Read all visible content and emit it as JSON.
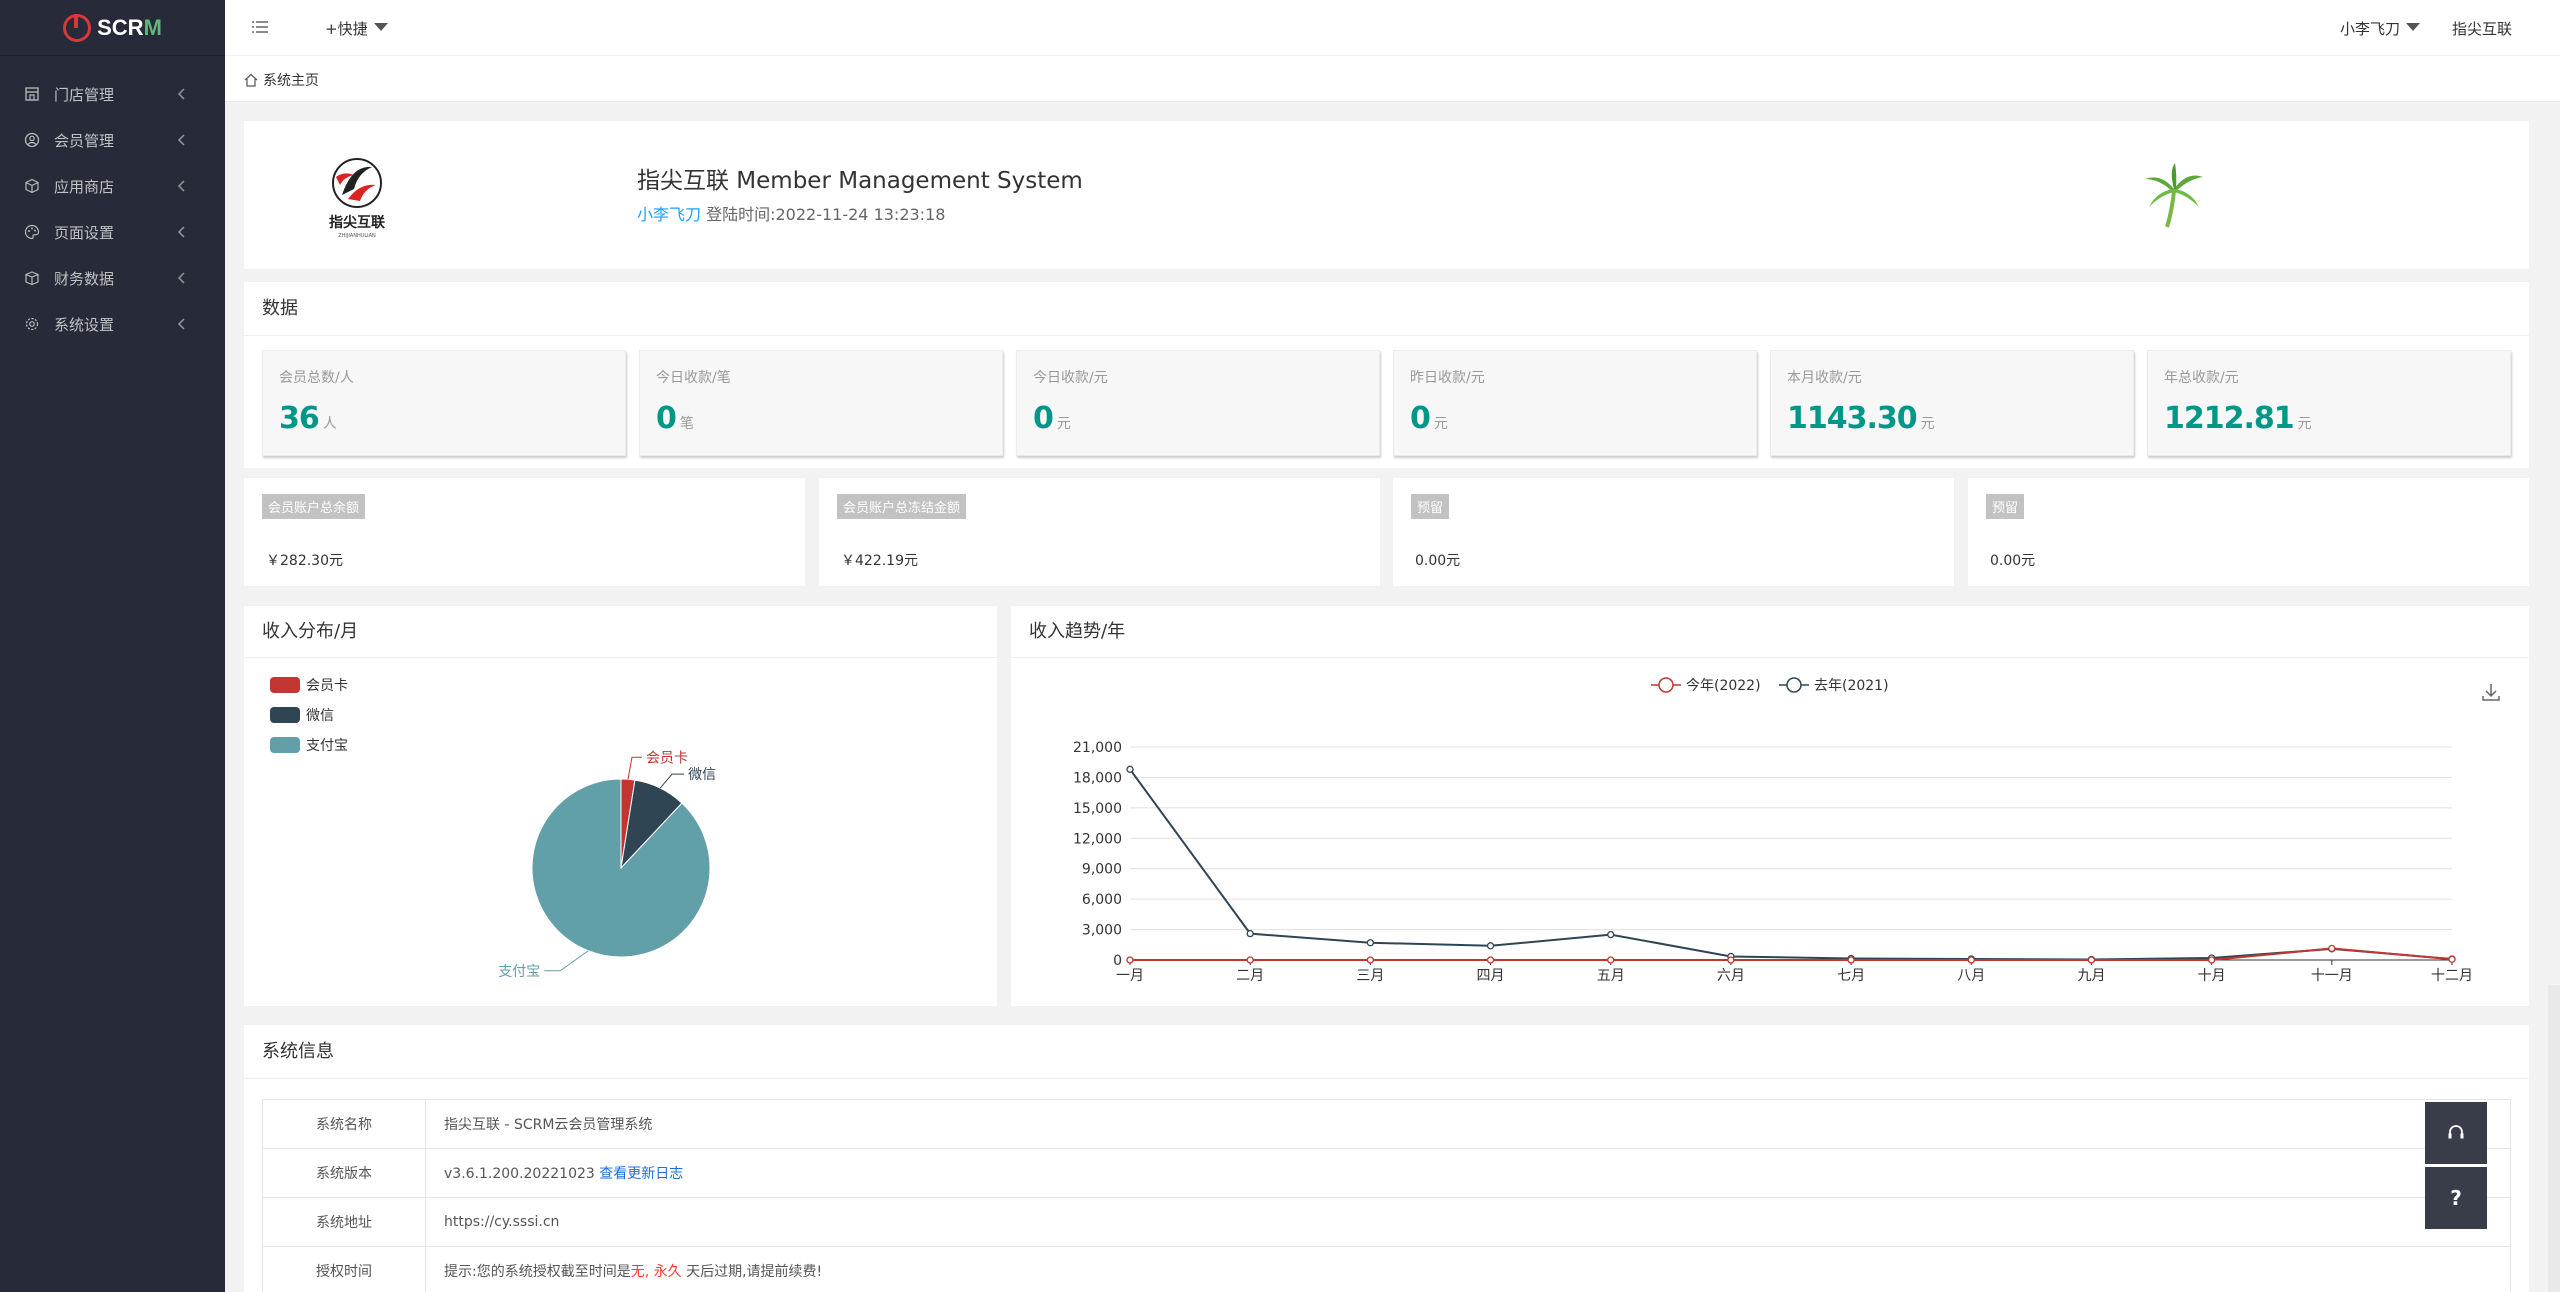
{
  "app": {
    "logo_text_main": "SCR",
    "logo_text_accent": "M"
  },
  "sidebar": {
    "items": [
      {
        "label": "门店管理",
        "icon": "store-icon"
      },
      {
        "label": "会员管理",
        "icon": "user-circle-icon"
      },
      {
        "label": "应用商店",
        "icon": "cube-icon"
      },
      {
        "label": "页面设置",
        "icon": "palette-icon"
      },
      {
        "label": "财务数据",
        "icon": "box-icon"
      },
      {
        "label": "系统设置",
        "icon": "gear-icon"
      }
    ]
  },
  "header": {
    "quick_label": "+快捷",
    "user_name": "小李飞刀",
    "brand": "指尖互联"
  },
  "breadcrumb": {
    "home": "系统主页"
  },
  "welcome": {
    "title": "指尖互联 Member Management System",
    "user": "小李飞刀",
    "login_text": "登陆时间:2022-11-24 13:23:18",
    "logo_caption": "指尖互联",
    "logo_sub": "ZHIJIANHULIAN"
  },
  "data_section": {
    "title": "数据",
    "stats": [
      {
        "label": "会员总数/人",
        "value": "36",
        "unit": "人"
      },
      {
        "label": "今日收款/笔",
        "value": "0",
        "unit": "笔"
      },
      {
        "label": "今日收款/元",
        "value": "0",
        "unit": "元"
      },
      {
        "label": "昨日收款/元",
        "value": "0",
        "unit": "元"
      },
      {
        "label": "本月收款/元",
        "value": "1143.30",
        "unit": "元"
      },
      {
        "label": "年总收款/元",
        "value": "1212.81",
        "unit": "元"
      }
    ]
  },
  "balances": [
    {
      "label": "会员账户总余额",
      "value": "￥282.30元"
    },
    {
      "label": "会员账户总冻结金额",
      "value": "￥422.19元"
    },
    {
      "label": "预留",
      "value": "0.00元"
    },
    {
      "label": "预留",
      "value": "0.00元"
    }
  ],
  "pie_card": {
    "title": "收入分布/月"
  },
  "line_card": {
    "title": "收入趋势/年"
  },
  "chart_data": [
    {
      "type": "pie",
      "title": "收入分布/月",
      "legend": "top-left",
      "slices": [
        {
          "name": "会员卡",
          "value": 2.5,
          "color": "#c23531"
        },
        {
          "name": "微信",
          "value": 9.5,
          "color": "#2f4554"
        },
        {
          "name": "支付宝",
          "value": 88,
          "color": "#61a0a8"
        }
      ]
    },
    {
      "type": "line",
      "title": "收入趋势/年",
      "legend": "top-center",
      "grid": true,
      "categories": [
        "一月",
        "二月",
        "三月",
        "四月",
        "五月",
        "六月",
        "七月",
        "八月",
        "九月",
        "十月",
        "十一月",
        "十二月"
      ],
      "yticks": [
        "0",
        "3,000",
        "6,000",
        "9,000",
        "12,000",
        "15,000",
        "18,000",
        "21,000"
      ],
      "ylim": [
        0,
        21000
      ],
      "series": [
        {
          "name": "今年(2022)",
          "color": "#c23531",
          "values": [
            0,
            0,
            0,
            0,
            0,
            0,
            0,
            0,
            0,
            0,
            1143,
            70
          ]
        },
        {
          "name": "去年(2021)",
          "color": "#2f4554",
          "values": [
            18800,
            2600,
            1700,
            1400,
            2500,
            350,
            150,
            100,
            50,
            200,
            1100,
            100
          ]
        }
      ]
    }
  ],
  "sysinfo": {
    "title": "系统信息",
    "rows": {
      "name_key": "系统名称",
      "name_val": "指尖互联 - SCRM云会员管理系统",
      "version_key": "系统版本",
      "version_val": "v3.6.1.200.20221023",
      "version_link": "查看更新日志",
      "url_key": "系统地址",
      "url_val": "https://cy.sssi.cn",
      "auth_key": "授权时间",
      "auth_prefix": "提示:您的系统授权截至时间是",
      "auth_none": "无,",
      "auth_forever": "永久",
      "auth_suffix": "天后过期,请提前续费!"
    }
  },
  "float_buttons": {
    "help": "?"
  }
}
